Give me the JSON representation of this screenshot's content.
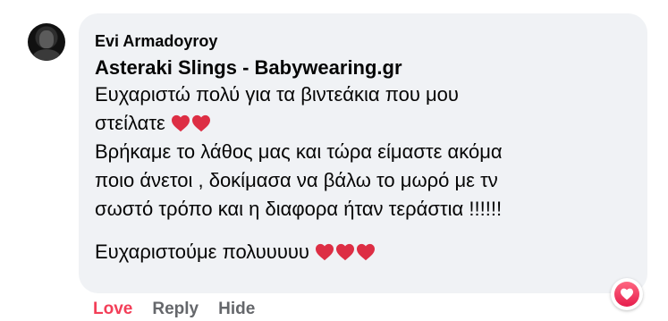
{
  "comment": {
    "author": "Evi Armadoyroy",
    "mention": "Asteraki Slings - Babywearing.gr",
    "lines": [
      "Ευχαριστώ πολύ για τα βιντεάκια που μου",
      "στείλατε",
      "Βρήκαμε το λάθος μας και τώρα είμαστε ακόμα",
      "ποιο άνετοι , δοκίμασα να βάλω το μωρό με τν",
      "σωστό τρόπο και η διαφορα ήταν τεράστια !!!!!!",
      "Ευχαριστούμε πολυυυυυ"
    ],
    "emoji_icon": "red-heart-icon",
    "reaction_icon": "love-reaction-icon"
  },
  "actions": {
    "love": "Love",
    "reply": "Reply",
    "hide": "Hide"
  },
  "colors": {
    "bubble": "#f0f2f5",
    "love": "#f33e58",
    "action": "#65676b",
    "text": "#050505",
    "heart": "#dd2e44"
  }
}
